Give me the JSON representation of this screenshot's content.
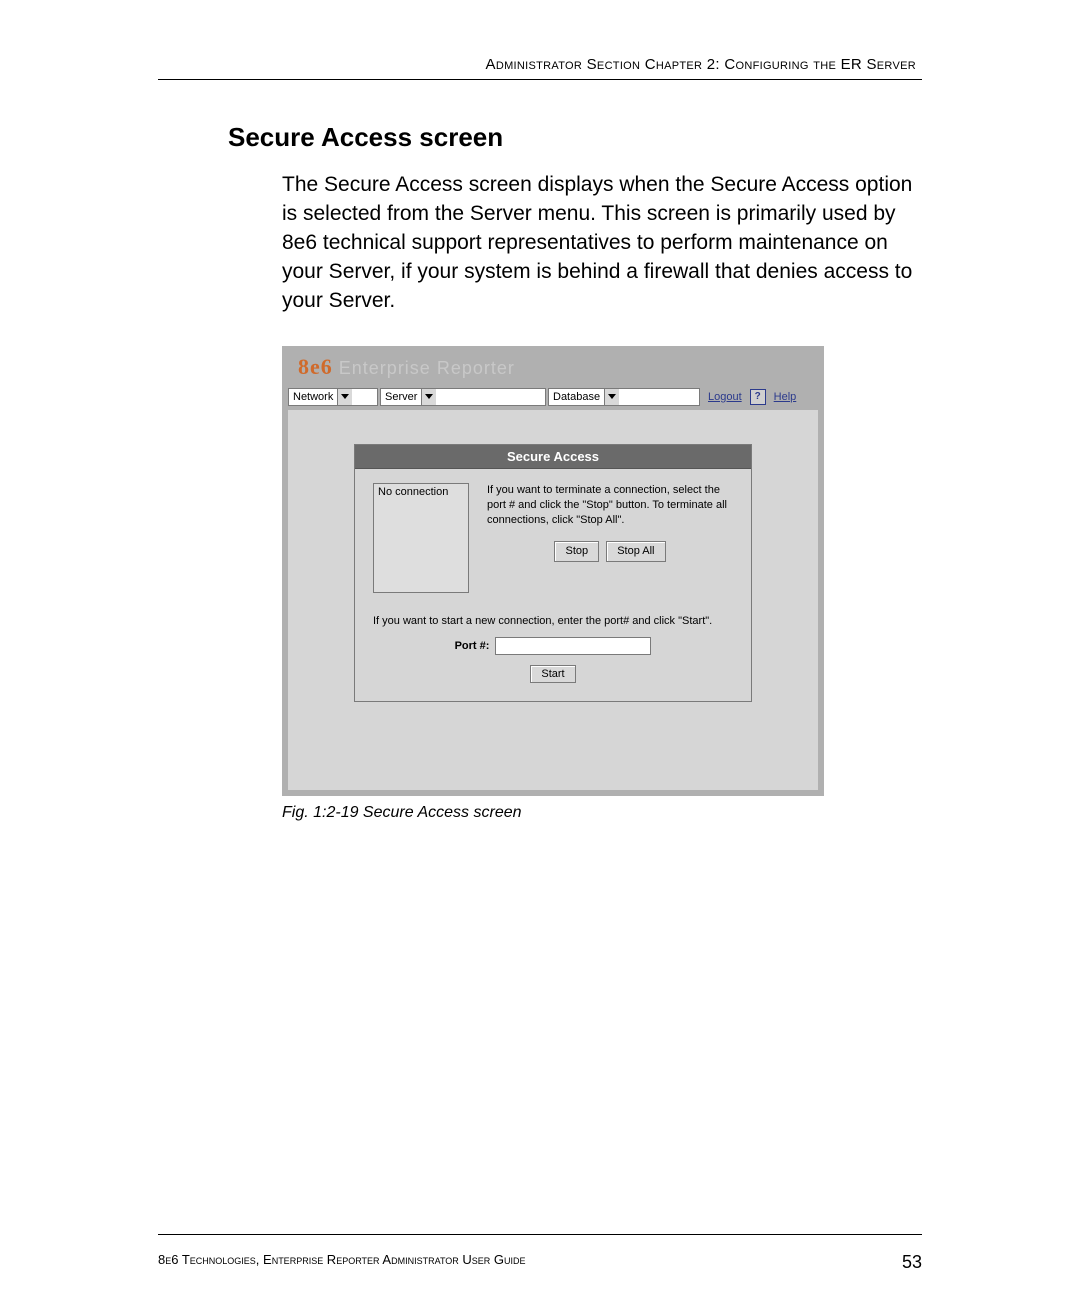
{
  "running_head": "Administrator Section  Chapter 2: Configuring the ER Server",
  "heading": "Secure Access screen",
  "body_text": "The Secure Access screen displays when the Secure Access option is selected from the Server menu. This screen is primarily used by 8e6 technical support represen­tatives to perform maintenance on your Server, if your system is behind a firewall that denies access to your Server.",
  "figure_caption": "Fig. 1:2-19  Secure Access screen",
  "footer_text": "8e6 Technologies, Enterprise Reporter Administrator User Guide",
  "footer_page": "53",
  "app": {
    "brand_logo": "8e6",
    "brand_name": "Enterprise Reporter",
    "menus": {
      "network": "Network",
      "server": "Server",
      "database": "Database"
    },
    "links": {
      "logout": "Logout",
      "help": "Help",
      "q": "?"
    },
    "panel": {
      "title": "Secure Access",
      "list_placeholder": "No connection",
      "terminate_text": "If you want to terminate a connection, select the port # and click the \"Stop\" button. To terminate all connections, click \"Stop All\".",
      "stop_btn": "Stop",
      "stopall_btn": "Stop All",
      "start_text": "If you want to start a new connection, enter the port# and click \"Start\".",
      "port_label": "Port #:",
      "port_value": "",
      "start_btn": "Start"
    }
  }
}
